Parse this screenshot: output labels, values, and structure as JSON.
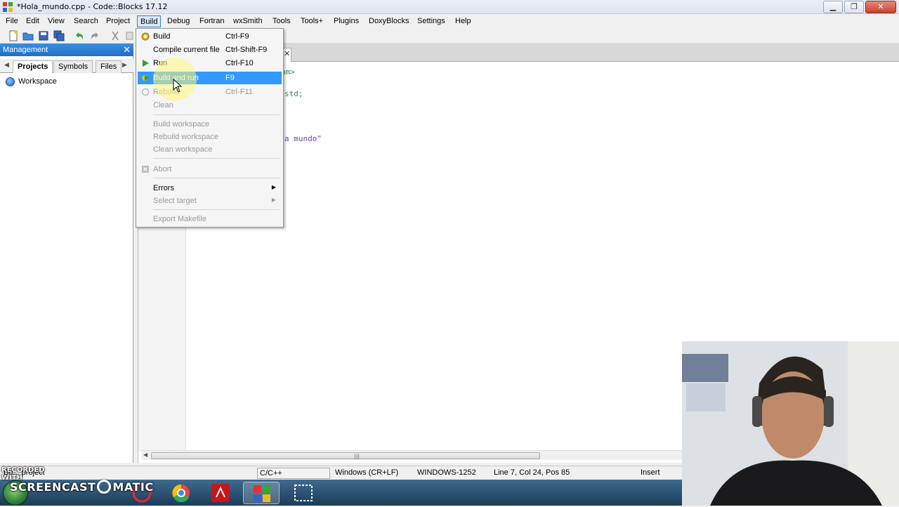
{
  "window": {
    "title": "*Hola_mundo.cpp - Code::Blocks 17.12"
  },
  "menubar": [
    "File",
    "Edit",
    "View",
    "Search",
    "Project",
    "Build",
    "Debug",
    "Fortran",
    "wxSmith",
    "Tools",
    "Tools+",
    "Plugins",
    "DoxyBlocks",
    "Settings",
    "Help"
  ],
  "management": {
    "title": "Management",
    "tabs": [
      "Projects",
      "Symbols",
      "Files"
    ],
    "workspace": "Workspace"
  },
  "editor": {
    "code_fragments": [
      "am>",
      "std;",
      "a mundo\""
    ]
  },
  "build_menu": {
    "items": [
      {
        "label": "Build",
        "shortcut": "Ctrl-F9",
        "enabled": true,
        "icon": "gear-icon"
      },
      {
        "label": "Compile current file",
        "shortcut": "Ctrl-Shift-F9",
        "enabled": true
      },
      {
        "label": "Run",
        "shortcut": "Ctrl-F10",
        "enabled": true,
        "icon": "play-icon"
      },
      {
        "label": "Build and run",
        "shortcut": "F9",
        "enabled": true,
        "icon": "build-run-icon",
        "highlighted": true
      },
      {
        "label": "Rebuild",
        "shortcut": "Ctrl-F11",
        "enabled": false,
        "icon": "rebuild-icon"
      },
      {
        "label": "Clean",
        "shortcut": "",
        "enabled": false
      },
      {
        "label": "Build workspace",
        "shortcut": "",
        "enabled": false
      },
      {
        "label": "Rebuild workspace",
        "shortcut": "",
        "enabled": false
      },
      {
        "label": "Clean workspace",
        "shortcut": "",
        "enabled": false
      },
      {
        "label": "Abort",
        "shortcut": "",
        "enabled": false,
        "icon": "abort-icon"
      },
      {
        "label": "Errors",
        "shortcut": "",
        "enabled": true,
        "submenu": true
      },
      {
        "label": "Select target",
        "shortcut": "",
        "enabled": false,
        "submenu": true
      },
      {
        "label": "Export Makefile",
        "shortcut": "",
        "enabled": false
      }
    ]
  },
  "statusbar": {
    "message": "Bu... project",
    "language": "C/C++",
    "line_endings": "Windows (CR+LF)",
    "encoding": "WINDOWS-1252",
    "position": "Line 7, Col 24, Pos 85",
    "mode": "Insert"
  },
  "watermark": {
    "small": "RECORDED WITH",
    "big_left": "SCREENCAST",
    "big_right": "MATIC"
  },
  "colors": {
    "accent": "#3399ff",
    "management_header": "#2a7fd4",
    "taskbar": "#2a4f70"
  }
}
